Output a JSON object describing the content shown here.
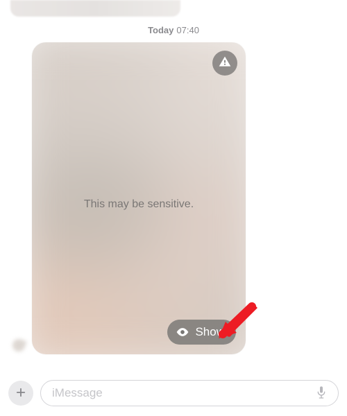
{
  "header": {
    "timestamp_day": "Today",
    "timestamp_time": "07:40"
  },
  "message": {
    "sensitive_text": "This may be sensitive.",
    "show_button_label": "Show"
  },
  "composer": {
    "placeholder": "iMessage",
    "value": ""
  },
  "icons": {
    "warning": "warning-triangle-icon",
    "eye": "eye-icon",
    "plus": "plus-icon",
    "mic": "microphone-icon",
    "annotation": "red-arrow-annotation"
  },
  "colors": {
    "annotation_arrow": "#ed1c24",
    "pill_bg": "#787674",
    "timestamp_text": "#8a8a8e"
  }
}
